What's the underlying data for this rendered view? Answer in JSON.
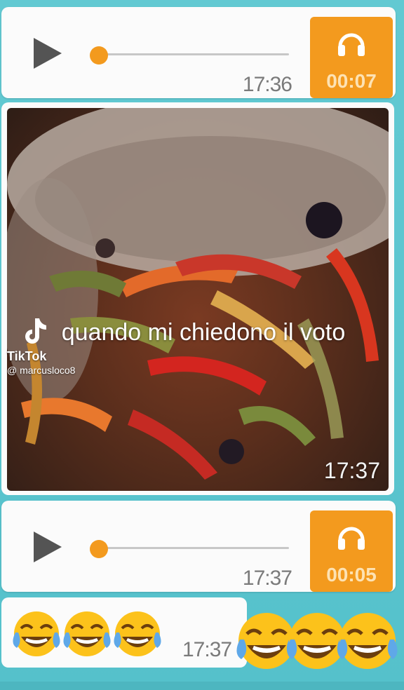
{
  "messages": [
    {
      "type": "voice",
      "time": "17:36",
      "duration": "00:07",
      "progress": 0.0
    },
    {
      "type": "video",
      "time": "17:37"
    },
    {
      "type": "voice",
      "time": "17:37",
      "duration": "00:05",
      "progress": 0.0
    },
    {
      "type": "emoji",
      "time": "17:37",
      "emoji_name": "face-with-tears-of-joy",
      "count": 3
    }
  ],
  "overlay": {
    "caption": "quando mi chiedono il voto",
    "tiktok_brand": "TikTok",
    "tiktok_handle": "@ marcusloco8",
    "big_emoji_name": "face-with-tears-of-joy",
    "big_emoji_count": 3
  },
  "colors": {
    "background": "#5cc6cf",
    "bubble": "#fbfbfb",
    "accent": "#f39a1e",
    "play_icon": "#545454"
  },
  "icons": {
    "play": "play-icon",
    "headphones": "headphones-icon",
    "tiktok_logo": "tiktok-logo-icon"
  }
}
